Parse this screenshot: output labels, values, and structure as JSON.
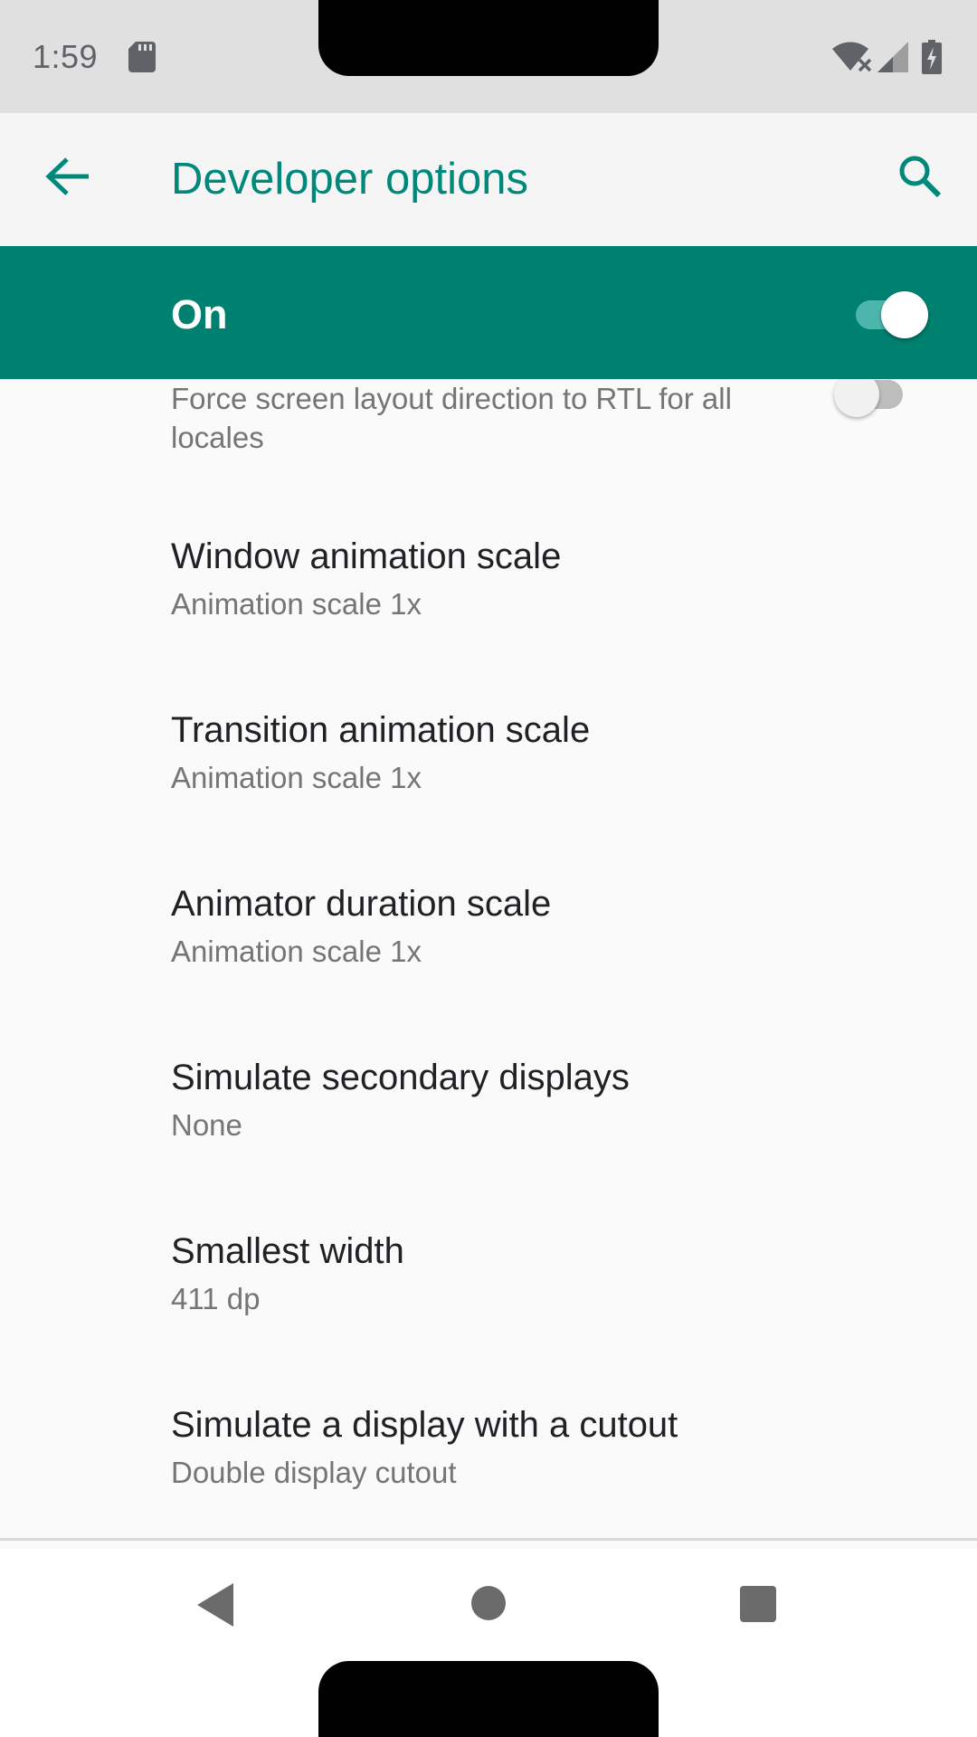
{
  "status_bar": {
    "time": "1:59",
    "icons": [
      "sd-card-icon",
      "wifi-off-icon",
      "cell-signal-icon",
      "battery-charging-icon"
    ]
  },
  "app_bar": {
    "title": "Developer options",
    "back_icon": "arrow-back-icon",
    "search_icon": "search-icon"
  },
  "master_switch": {
    "label": "On",
    "checked": true
  },
  "settings": {
    "rtl": {
      "summary": "Force screen layout direction to RTL for all locales",
      "checked": false
    },
    "window_animation": {
      "title": "Window animation scale",
      "summary": "Animation scale 1x"
    },
    "transition_animation": {
      "title": "Transition animation scale",
      "summary": "Animation scale 1x"
    },
    "animator_duration": {
      "title": "Animator duration scale",
      "summary": "Animation scale 1x"
    },
    "secondary_displays": {
      "title": "Simulate secondary displays",
      "summary": "None"
    },
    "smallest_width": {
      "title": "Smallest width",
      "summary": "411 dp"
    },
    "display_cutout": {
      "title": "Simulate a display with a cutout",
      "summary": "Double display cutout"
    }
  },
  "colors": {
    "accent": "#00897b",
    "master_bar": "#00806f",
    "background": "#fafafa",
    "status_bar": "#e0e0e0"
  },
  "nav_bar": {
    "icons": [
      "nav-back-icon",
      "nav-home-icon",
      "nav-recents-icon"
    ]
  }
}
